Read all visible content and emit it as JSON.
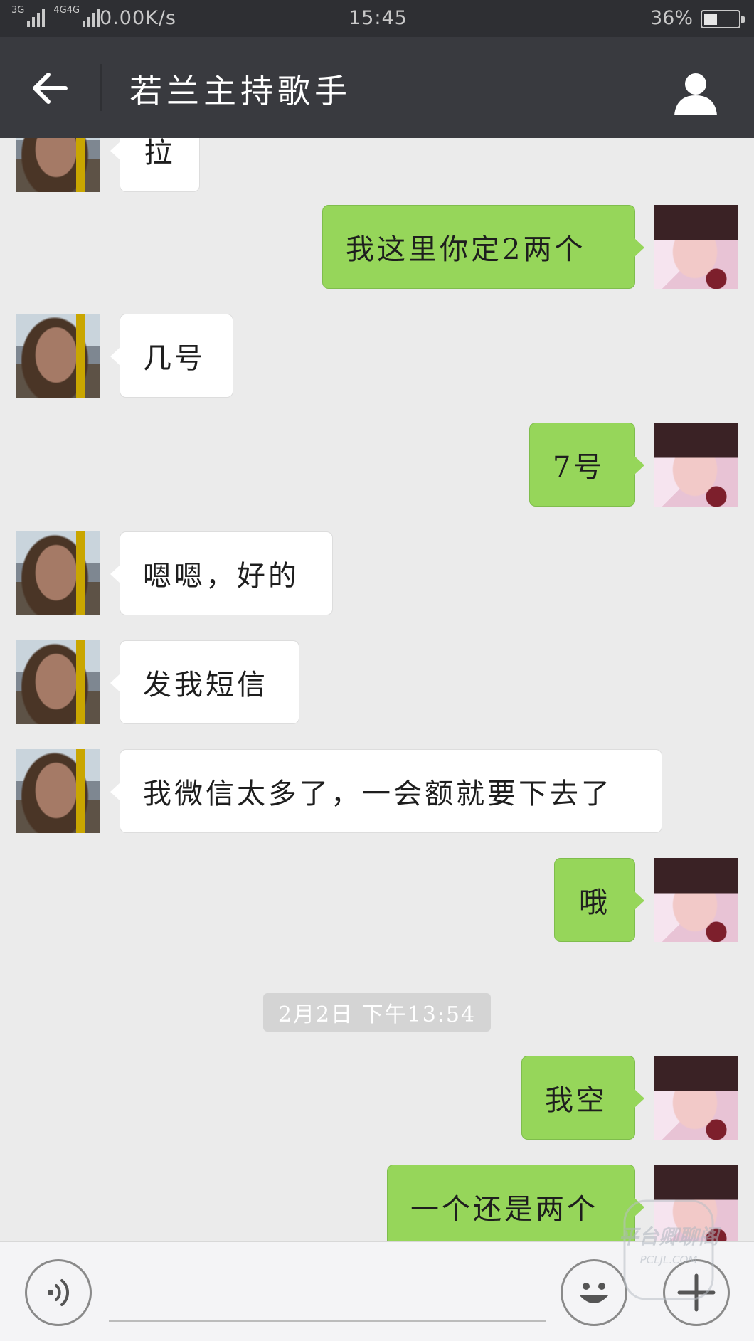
{
  "status_bar": {
    "network_left": "3G",
    "network_right": "4G4G",
    "speed": "0.00K/s",
    "time": "15:45",
    "battery": "36%",
    "battery_level": 0.36
  },
  "header": {
    "title": "若兰主持歌手",
    "back_icon": "arrow-left-icon",
    "profile_icon": "person-icon"
  },
  "messages": [
    {
      "side": "left",
      "text": "拉"
    },
    {
      "side": "right",
      "text": "我这里你定2两个"
    },
    {
      "side": "left",
      "text": "几号"
    },
    {
      "side": "right",
      "text": "7号"
    },
    {
      "side": "left",
      "text": "嗯嗯，好的"
    },
    {
      "side": "left",
      "text": "发我短信"
    },
    {
      "side": "left",
      "text": "我微信太多了，一会额就要下去了"
    },
    {
      "side": "right",
      "text": "哦"
    },
    {
      "side": "right",
      "text": "我空"
    },
    {
      "side": "right",
      "text": "一个还是两个"
    }
  ],
  "timestamp": "2月2日 下午13:54",
  "input_bar": {
    "placeholder": "",
    "voice_icon": "voice-icon",
    "emoji_icon": "emoji-icon",
    "plus_icon": "plus-icon"
  },
  "watermark": {
    "line1": "平台卿聊阁",
    "line2": "PCLJL.COM"
  },
  "colors": {
    "header_bg": "#393a3f",
    "chat_bg": "#ebebeb",
    "outgoing_bubble": "#96d65a",
    "incoming_bubble": "#ffffff"
  }
}
